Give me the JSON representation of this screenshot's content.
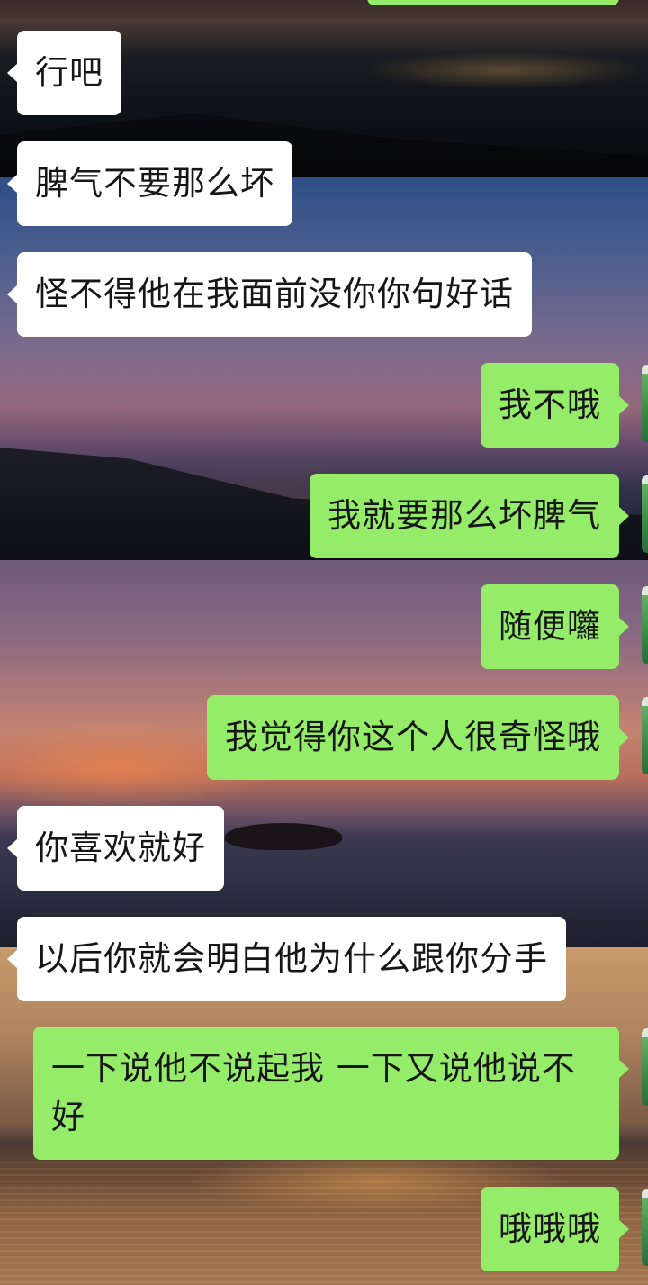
{
  "messages": [
    {
      "side": "right",
      "text": ""
    },
    {
      "side": "left",
      "text": "行吧"
    },
    {
      "side": "left",
      "text": "脾气不要那么坏"
    },
    {
      "side": "left",
      "text": "怪不得他在我面前没你你句好话"
    },
    {
      "side": "right",
      "text": "我不哦"
    },
    {
      "side": "right",
      "text": "我就要那么坏脾气"
    },
    {
      "side": "right",
      "text": "随便囖"
    },
    {
      "side": "right",
      "text": "我觉得你这个人很奇怪哦"
    },
    {
      "side": "left",
      "text": "你喜欢就好"
    },
    {
      "side": "left",
      "text": "以后你就会明白他为什么跟你分手"
    },
    {
      "side": "right",
      "text": "一下说他不说起我 一下又说他说不好"
    },
    {
      "side": "right",
      "text": "哦哦哦"
    }
  ],
  "colors": {
    "sent_bubble": "#95ec69",
    "received_bubble": "#ffffff",
    "text": "#161616"
  }
}
